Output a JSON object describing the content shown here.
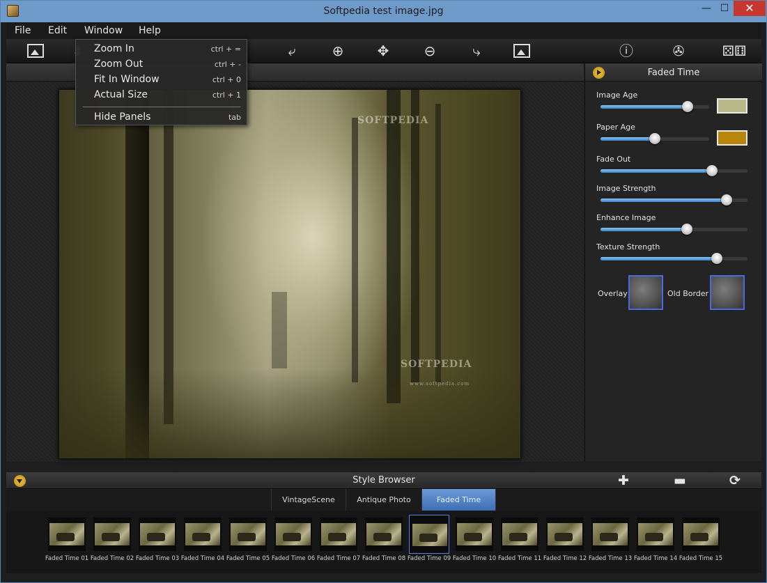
{
  "window": {
    "title": "Softpedia test image.jpg",
    "minimize": "—",
    "maximize": "☐",
    "close": "✕"
  },
  "menu": {
    "file": "File",
    "edit": "Edit",
    "window": "Window",
    "help": "Help"
  },
  "dropdown": {
    "items": [
      {
        "label": "Zoom In",
        "shortcut": "ctrl + ="
      },
      {
        "label": "Zoom Out",
        "shortcut": "ctrl + -"
      },
      {
        "label": "Fit In Window",
        "shortcut": "ctrl + 0"
      },
      {
        "label": "Actual Size",
        "shortcut": "ctrl + 1"
      },
      {
        "label": "Hide Panels",
        "shortcut": "tab"
      }
    ]
  },
  "toolbar": {
    "icons": [
      "open-image-icon",
      "save-icon",
      "undo-icon",
      "zoom-in-icon",
      "move-icon",
      "zoom-out-icon",
      "redo-icon",
      "export-image-icon",
      "info-icon",
      "settings-icon",
      "random-dice-icon"
    ]
  },
  "image": {
    "watermark_top": "SOFTPEDIA",
    "watermark_bottom": "SOFTPEDIA",
    "watermark_url": "www.softpedia.com",
    "watermark_left": "SOFTPEDIA"
  },
  "panel": {
    "title": "Faded Time",
    "sliders": [
      {
        "label": "Image Age",
        "value": 0.8
      },
      {
        "label": "Paper Age",
        "value": 0.5
      },
      {
        "label": "Fade Out",
        "value": 0.76
      },
      {
        "label": "Image Strength",
        "value": 0.86
      },
      {
        "label": "Enhance Image",
        "value": 0.59
      },
      {
        "label": "Texture Strength",
        "value": 0.79
      }
    ],
    "image_age_color": "#b8b88a",
    "paper_age_color": "#b8860b",
    "overlay_label": "Overlay",
    "old_border_label": "Old Border"
  },
  "style_browser": {
    "title": "Style Browser",
    "add": "✚",
    "remove": "▬",
    "reset": "⟳",
    "tabs": [
      "VintageScene",
      "Antique Photo",
      "Faded Time"
    ],
    "active_tab": "Faded Time",
    "thumbnails": [
      "Faded Time 01",
      "Faded Time 02",
      "Faded Time 03",
      "Faded Time 04",
      "Faded Time 05",
      "Faded Time 06",
      "Faded Time 07",
      "Faded Time 08",
      "Faded Time 09",
      "Faded Time 10",
      "Faded Time 11",
      "Faded Time 12",
      "Faded Time 13",
      "Faded Time 14",
      "Faded Time 15"
    ],
    "selected_thumbnail": "Faded Time 09"
  }
}
